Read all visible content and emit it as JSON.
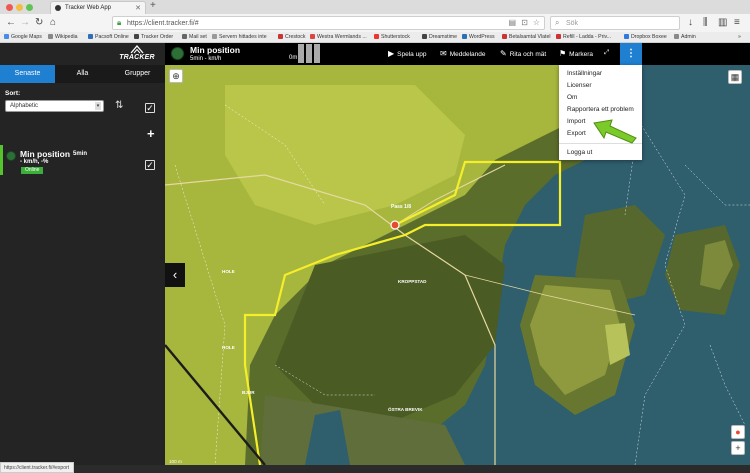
{
  "browser": {
    "tab_title": "Tracker Web App",
    "url": "https://client.tracker.fi/#",
    "search_placeholder": "Sök",
    "bookmarks": [
      "Google Maps",
      "Wikipedia",
      "Pacsoft Online",
      "Tracker Order",
      "Mail set",
      "Servern hittades inte",
      "Crestock",
      "Westra Wermlands ...",
      "Shutterstock",
      "Dreamstime",
      "WordPress",
      "Betalsamtal Vlatel",
      "Refill - Ladda - Priv...",
      "Dropbox Boxee",
      "Admin"
    ],
    "status_url": "https://client.tracker.fi/#export"
  },
  "sidebar": {
    "logo": "TRACKER",
    "tabs": [
      "Senaste",
      "Alla",
      "Grupper"
    ],
    "active_tab": 0,
    "sort_label": "Sort:",
    "sort_value": "Alphabetic",
    "device": {
      "name": "Min position",
      "time": "5min",
      "speed": "- km/h,  -%",
      "status": "Online"
    }
  },
  "topbar": {
    "name": "Min position",
    "sub": "5min   - km/h",
    "zoom_label": "0m",
    "buttons": [
      "Spela upp",
      "Meddelande",
      "Rita och mät",
      "Markera"
    ],
    "icons": [
      "play-icon",
      "message-icon",
      "pencil-icon",
      "pin-icon",
      "expand-icon",
      "more-icon"
    ]
  },
  "menu": {
    "items": [
      "Inställningar",
      "Licenser",
      "Om",
      "Rapportera ett problem",
      "Import",
      "Export",
      "Logga ut"
    ]
  },
  "map": {
    "labels": {
      "pin": "Pass 1/8",
      "a": "KROPPSTAD",
      "b": "ÖSTRA BREVIK",
      "c": "HOLE",
      "d": "HOLE",
      "e": "BJUR"
    },
    "scale": "100 m",
    "colors": {
      "track": "#f5ee2a",
      "forest": "#6e7a32",
      "water": "#2c5b6b",
      "highlight": "#d3e05a"
    }
  }
}
